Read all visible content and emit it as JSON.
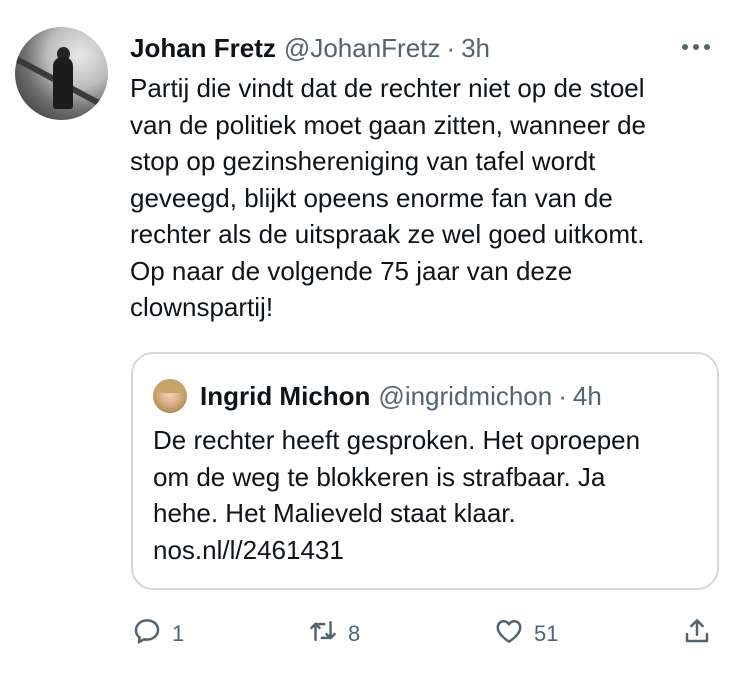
{
  "tweet": {
    "author_name": "Johan Fretz",
    "author_handle": "@JohanFretz",
    "separator": "·",
    "time": "3h",
    "text": "Partij die vindt dat de rechter niet op de stoel\nvan de politiek moet gaan zitten, wanneer de\nstop op gezinshereniging van tafel wordt\ngeveegd, blijkt opeens enorme fan van de\nrechter als de uitspraak ze wel goed uitkomt.\nOp naar de volgende 75 jaar van deze\nclownspartij!"
  },
  "quoted_tweet": {
    "author_name": "Ingrid Michon",
    "author_handle": "@ingridmichon",
    "separator": "·",
    "time": "4h",
    "text": "De rechter heeft gesproken. Het oproepen\nom de weg te blokkeren is strafbaar. Ja\nhehe. Het Malieveld staat klaar.",
    "link": "nos.nl/l/2461431"
  },
  "actions": {
    "replies": "1",
    "retweets": "8",
    "likes": "51"
  },
  "icons": {
    "more": "more-dots-icon",
    "reply": "reply-icon",
    "retweet": "retweet-icon",
    "like": "heart-icon",
    "share": "share-icon"
  },
  "colors": {
    "text": "#0f1419",
    "secondary": "#536471",
    "border": "#cfd9de"
  }
}
